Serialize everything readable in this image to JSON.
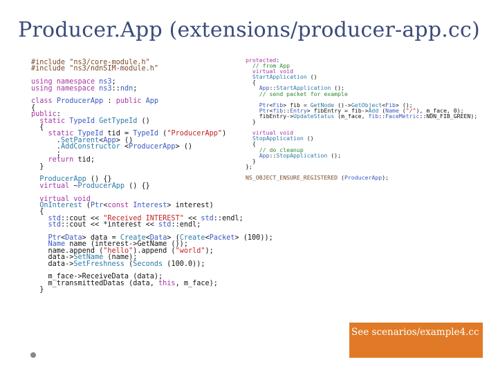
{
  "title": "Producer.App (extensions/producer-app.cc)",
  "code_left": [
    [
      [
        "pp",
        "#include \"ns3/core-module.h\""
      ]
    ],
    [
      [
        "pp",
        "#include \"ns3/ndnSIM-module.h\""
      ]
    ],
    [],
    [
      [
        "k",
        "using namespace "
      ],
      [
        "t",
        "ns3"
      ],
      [
        "p",
        ";"
      ]
    ],
    [
      [
        "k",
        "using namespace "
      ],
      [
        "t",
        "ns3"
      ],
      [
        "p",
        "::"
      ],
      [
        "t",
        "ndn"
      ],
      [
        "p",
        ";"
      ]
    ],
    [],
    [
      [
        "k",
        "class "
      ],
      [
        "t",
        "ProducerApp"
      ],
      [
        "p",
        " : "
      ],
      [
        "k",
        "public "
      ],
      [
        "t",
        "App"
      ]
    ],
    [
      [
        "p",
        "{"
      ]
    ],
    [
      [
        "k",
        "public"
      ],
      [
        "p",
        ":"
      ]
    ],
    [
      [
        "p",
        "  "
      ],
      [
        "k",
        "static "
      ],
      [
        "t",
        "TypeId "
      ],
      [
        "f",
        "GetTypeId"
      ],
      [
        "p",
        " ()"
      ]
    ],
    [
      [
        "p",
        "  {"
      ]
    ],
    [
      [
        "p",
        "    "
      ],
      [
        "k",
        "static "
      ],
      [
        "t",
        "TypeId "
      ],
      [
        "p",
        "tid = "
      ],
      [
        "t",
        "TypeId"
      ],
      [
        "p",
        " ("
      ],
      [
        "s",
        "\"ProducerApp\""
      ],
      [
        "p",
        ")"
      ]
    ],
    [
      [
        "p",
        "      ."
      ],
      [
        "f",
        "SetParent"
      ],
      [
        "p",
        "<"
      ],
      [
        "t",
        "App"
      ],
      [
        "p",
        "> ()"
      ]
    ],
    [
      [
        "p",
        "      ."
      ],
      [
        "f",
        "AddConstructor"
      ],
      [
        "p",
        " <"
      ],
      [
        "t",
        "ProducerApp"
      ],
      [
        "p",
        "> ()"
      ]
    ],
    [
      [
        "p",
        "      ;"
      ]
    ],
    [
      [
        "p",
        "    "
      ],
      [
        "k",
        "return "
      ],
      [
        "p",
        "tid;"
      ]
    ],
    [
      [
        "p",
        "  }"
      ]
    ],
    [],
    [
      [
        "p",
        "  "
      ],
      [
        "f",
        "ProducerApp"
      ],
      [
        "p",
        " () {}"
      ]
    ],
    [
      [
        "p",
        "  "
      ],
      [
        "k",
        "virtual "
      ],
      [
        "p",
        "~"
      ],
      [
        "f",
        "ProducerApp"
      ],
      [
        "p",
        " () {}"
      ]
    ],
    [],
    [
      [
        "p",
        "  "
      ],
      [
        "k",
        "virtual void"
      ]
    ],
    [
      [
        "p",
        "  "
      ],
      [
        "f",
        "OnInterest"
      ],
      [
        "p",
        " ("
      ],
      [
        "t",
        "Ptr"
      ],
      [
        "p",
        "<"
      ],
      [
        "k",
        "const "
      ],
      [
        "t",
        "Interest"
      ],
      [
        "p",
        "> interest)"
      ]
    ],
    [
      [
        "p",
        "  {"
      ]
    ],
    [
      [
        "p",
        "    "
      ],
      [
        "t",
        "std"
      ],
      [
        "p",
        "::cout << "
      ],
      [
        "s",
        "\"Received INTEREST\""
      ],
      [
        "p",
        " << "
      ],
      [
        "t",
        "std"
      ],
      [
        "p",
        "::endl;"
      ]
    ],
    [
      [
        "p",
        "    "
      ],
      [
        "t",
        "std"
      ],
      [
        "p",
        "::cout << *interest << "
      ],
      [
        "t",
        "std"
      ],
      [
        "p",
        "::endl;"
      ]
    ],
    [],
    [
      [
        "p",
        "    "
      ],
      [
        "t",
        "Ptr"
      ],
      [
        "p",
        "<"
      ],
      [
        "t",
        "Data"
      ],
      [
        "p",
        "> data = "
      ],
      [
        "f",
        "Create"
      ],
      [
        "p",
        "<"
      ],
      [
        "t",
        "Data"
      ],
      [
        "p",
        "> ("
      ],
      [
        "f",
        "Create"
      ],
      [
        "p",
        "<"
      ],
      [
        "t",
        "Packet"
      ],
      [
        "p",
        "> (100));"
      ]
    ],
    [
      [
        "p",
        "    "
      ],
      [
        "t",
        "Name "
      ],
      [
        "p",
        "name (interest->GetName ());"
      ]
    ],
    [
      [
        "p",
        "    name.append ("
      ],
      [
        "s",
        "\"hello\""
      ],
      [
        "p",
        ").append ("
      ],
      [
        "s",
        "\"world\""
      ],
      [
        "p",
        ");"
      ]
    ],
    [
      [
        "p",
        "    data->"
      ],
      [
        "f",
        "SetName"
      ],
      [
        "p",
        " (name);"
      ]
    ],
    [
      [
        "p",
        "    data->"
      ],
      [
        "f",
        "SetFreshness"
      ],
      [
        "p",
        " ("
      ],
      [
        "f",
        "Seconds"
      ],
      [
        "p",
        " (100.0));"
      ]
    ],
    [],
    [
      [
        "p",
        "    m_face->ReceiveData (data);"
      ]
    ],
    [
      [
        "p",
        "    m_transmittedDatas (data, "
      ],
      [
        "k",
        "this"
      ],
      [
        "p",
        ", m_face);"
      ]
    ],
    [
      [
        "p",
        "  }"
      ]
    ]
  ],
  "code_right": [
    [
      [
        "k",
        "protected"
      ],
      [
        "p",
        ":"
      ]
    ],
    [
      [
        "p",
        "  "
      ],
      [
        "c",
        "// from App"
      ]
    ],
    [
      [
        "p",
        "  "
      ],
      [
        "k",
        "virtual void"
      ]
    ],
    [
      [
        "p",
        "  "
      ],
      [
        "f",
        "StartApplication"
      ],
      [
        "p",
        " ()"
      ]
    ],
    [
      [
        "p",
        "  {"
      ]
    ],
    [
      [
        "p",
        "    "
      ],
      [
        "t",
        "App"
      ],
      [
        "p",
        "::"
      ],
      [
        "f",
        "StartApplication"
      ],
      [
        "p",
        " ();"
      ]
    ],
    [
      [
        "p",
        "    "
      ],
      [
        "c",
        "// send packet for example"
      ]
    ],
    [],
    [
      [
        "p",
        "    "
      ],
      [
        "t",
        "Ptr"
      ],
      [
        "p",
        "<"
      ],
      [
        "t",
        "Fib"
      ],
      [
        "p",
        "> fib = "
      ],
      [
        "f",
        "GetNode"
      ],
      [
        "p",
        " ()->"
      ],
      [
        "f",
        "GetObject"
      ],
      [
        "p",
        "<"
      ],
      [
        "t",
        "Fib"
      ],
      [
        "p",
        "> ();"
      ]
    ],
    [
      [
        "p",
        "    "
      ],
      [
        "t",
        "Ptr"
      ],
      [
        "p",
        "<"
      ],
      [
        "t",
        "fib"
      ],
      [
        "p",
        "::"
      ],
      [
        "t",
        "Entry"
      ],
      [
        "p",
        "> fibEntry = fib->"
      ],
      [
        "f",
        "Add"
      ],
      [
        "p",
        " ("
      ],
      [
        "t",
        "Name"
      ],
      [
        "p",
        " ("
      ],
      [
        "s",
        "\"/\""
      ],
      [
        "p",
        "), m_face, 0);"
      ]
    ],
    [
      [
        "p",
        "    fibEntry->"
      ],
      [
        "f",
        "UpdateStatus"
      ],
      [
        "p",
        " (m_face, "
      ],
      [
        "t",
        "fib"
      ],
      [
        "p",
        "::"
      ],
      [
        "t",
        "FaceMetric"
      ],
      [
        "p",
        "::NDN_FIB_GREEN);"
      ]
    ],
    [
      [
        "p",
        "  }"
      ]
    ],
    [],
    [
      [
        "p",
        "  "
      ],
      [
        "k",
        "virtual void"
      ]
    ],
    [
      [
        "p",
        "  "
      ],
      [
        "f",
        "StopApplication"
      ],
      [
        "p",
        " ()"
      ]
    ],
    [
      [
        "p",
        "  {"
      ]
    ],
    [
      [
        "p",
        "    "
      ],
      [
        "c",
        "// do cleanup"
      ]
    ],
    [
      [
        "p",
        "    "
      ],
      [
        "t",
        "App"
      ],
      [
        "p",
        "::"
      ],
      [
        "f",
        "StopApplication"
      ],
      [
        "p",
        " ();"
      ]
    ],
    [
      [
        "p",
        "  }"
      ]
    ],
    [
      [
        "p",
        "};"
      ]
    ],
    [],
    [
      [
        "pp",
        "NS_OBJECT_ENSURE_REGISTERED"
      ],
      [
        "p",
        " ("
      ],
      [
        "t",
        "ProducerApp"
      ],
      [
        "p",
        ");"
      ]
    ]
  ],
  "note": {
    "text": "See scenarios/example4.cc"
  },
  "colors": {
    "title": "#3a4a7a",
    "note_bg": "#e07a26",
    "keyword": "#a833a5",
    "type": "#3a58c0",
    "string": "#c42222",
    "comment": "#2c8a2c"
  }
}
